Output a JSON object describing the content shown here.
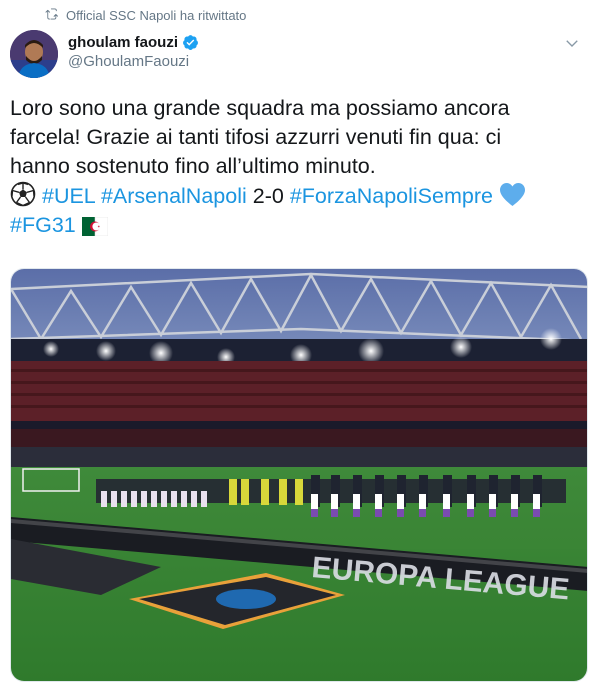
{
  "retweet": {
    "icon": "retweet-icon",
    "text": "Official SSC Napoli ha ritwittato"
  },
  "author": {
    "display_name": "ghoulam faouzi",
    "handle": "@GhoulamFaouzi",
    "verified": true,
    "avatar_icon": "avatar"
  },
  "menu": {
    "icon": "chevron-down-icon"
  },
  "tweet": {
    "line1": "Loro sono una grande squadra ma possiamo ancora",
    "line2": "farcela! Grazie ai tanti tifosi azzurri venuti fin qua: ci",
    "line3": "hanno sostenuto fino all’ultimo minuto.",
    "hashtag_uel": "#UEL",
    "hashtag_arsenalnapoli": "#ArsenalNapoli",
    "score": "2-0",
    "hashtag_forzanapolisempre": "#ForzaNapoliSempre",
    "hashtag_fg31": "#FG31",
    "emojis": [
      "soccer-ball-icon",
      "blue-heart-icon",
      "algeria-flag-icon"
    ]
  },
  "media": {
    "type": "photo",
    "banner_text": "EUROPA LEAGUE"
  },
  "colors": {
    "link": "#1b95e0",
    "text": "#14171a",
    "secondary": "#657786",
    "verified": "#1da1f2",
    "heart": "#5dadec"
  }
}
